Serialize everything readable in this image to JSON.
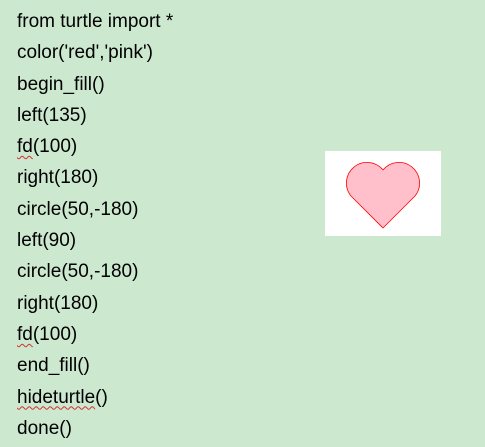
{
  "code": {
    "lines": [
      "from turtle import *",
      "color('red','pink')",
      "begin_fill()",
      "left(135)",
      "fd(100)",
      "right(180)",
      "circle(50,-180)",
      "left(90)",
      "circle(50,-180)",
      "right(180)",
      "fd(100)",
      "end_fill()",
      "hideturtle()",
      "done()"
    ]
  },
  "preview": {
    "shape_icon": "heart-icon",
    "fill_color": "#ffc0cb",
    "stroke_color": "#ff0000",
    "background": "#ffffff"
  },
  "colors": {
    "page_background": "#cce8cf",
    "spellcheck_underline": "#d32f2f"
  }
}
